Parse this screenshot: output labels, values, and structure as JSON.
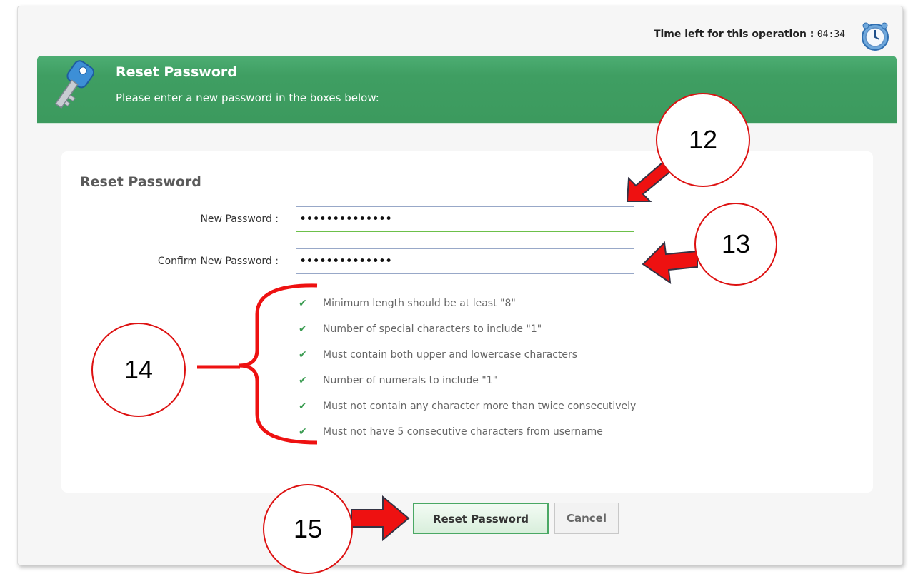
{
  "timer": {
    "label": "Time left for this operation :",
    "value": "04:34"
  },
  "banner": {
    "title": "Reset Password",
    "subtitle": "Please enter a new password in the boxes below:"
  },
  "form": {
    "title": "Reset Password",
    "new_password_label": "New Password :",
    "new_password_value": "••••••••••••••",
    "confirm_password_label": "Confirm New Password :",
    "confirm_password_value": "••••••••••••••"
  },
  "rules": [
    "Minimum length should be at least \"8\"",
    "Number of special characters to include \"1\"",
    "Must contain both upper and lowercase characters",
    "Number of numerals to include \"1\"",
    "Must not contain any character more than twice consecutively",
    "Must not have 5 consecutive characters from username"
  ],
  "buttons": {
    "reset": "Reset Password",
    "cancel": "Cancel"
  },
  "callouts": [
    "12",
    "13",
    "14",
    "15"
  ],
  "colors": {
    "banner": "#3f9e62",
    "callout": "#dd1111",
    "check": "#3b9c52"
  },
  "icons": {
    "check": "✔"
  }
}
